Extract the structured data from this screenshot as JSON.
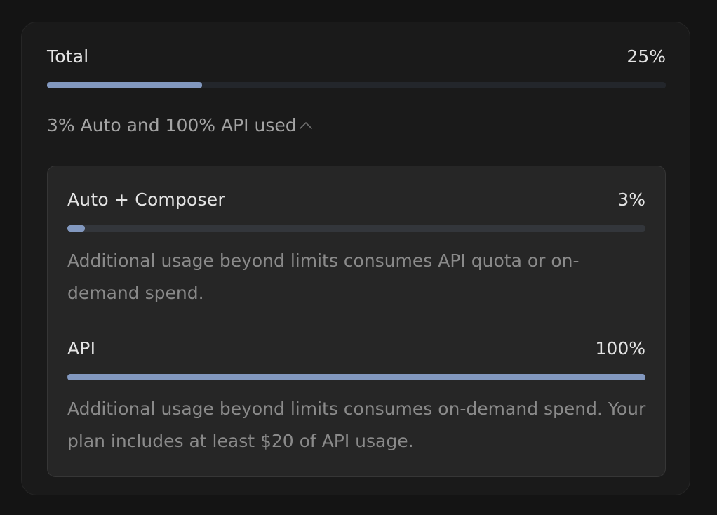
{
  "total": {
    "label": "Total",
    "percent_text": "25%",
    "progress": 0.25
  },
  "summary": {
    "text": "3% Auto and 100% API used",
    "toggle_icon": "chevron-up-icon"
  },
  "breakdown": [
    {
      "label": "Auto + Composer",
      "percent_text": "3%",
      "progress": 0.03,
      "note": "Additional usage beyond limits consumes API quota or on-demand spend."
    },
    {
      "label": "API",
      "percent_text": "100%",
      "progress": 1.0,
      "note": "Additional usage beyond limits consumes on-demand spend. Your plan includes at least $20 of API usage."
    }
  ],
  "colors": {
    "fill": "#8298bf",
    "track_outer": "#23262b",
    "track_inner": "#33363b"
  }
}
